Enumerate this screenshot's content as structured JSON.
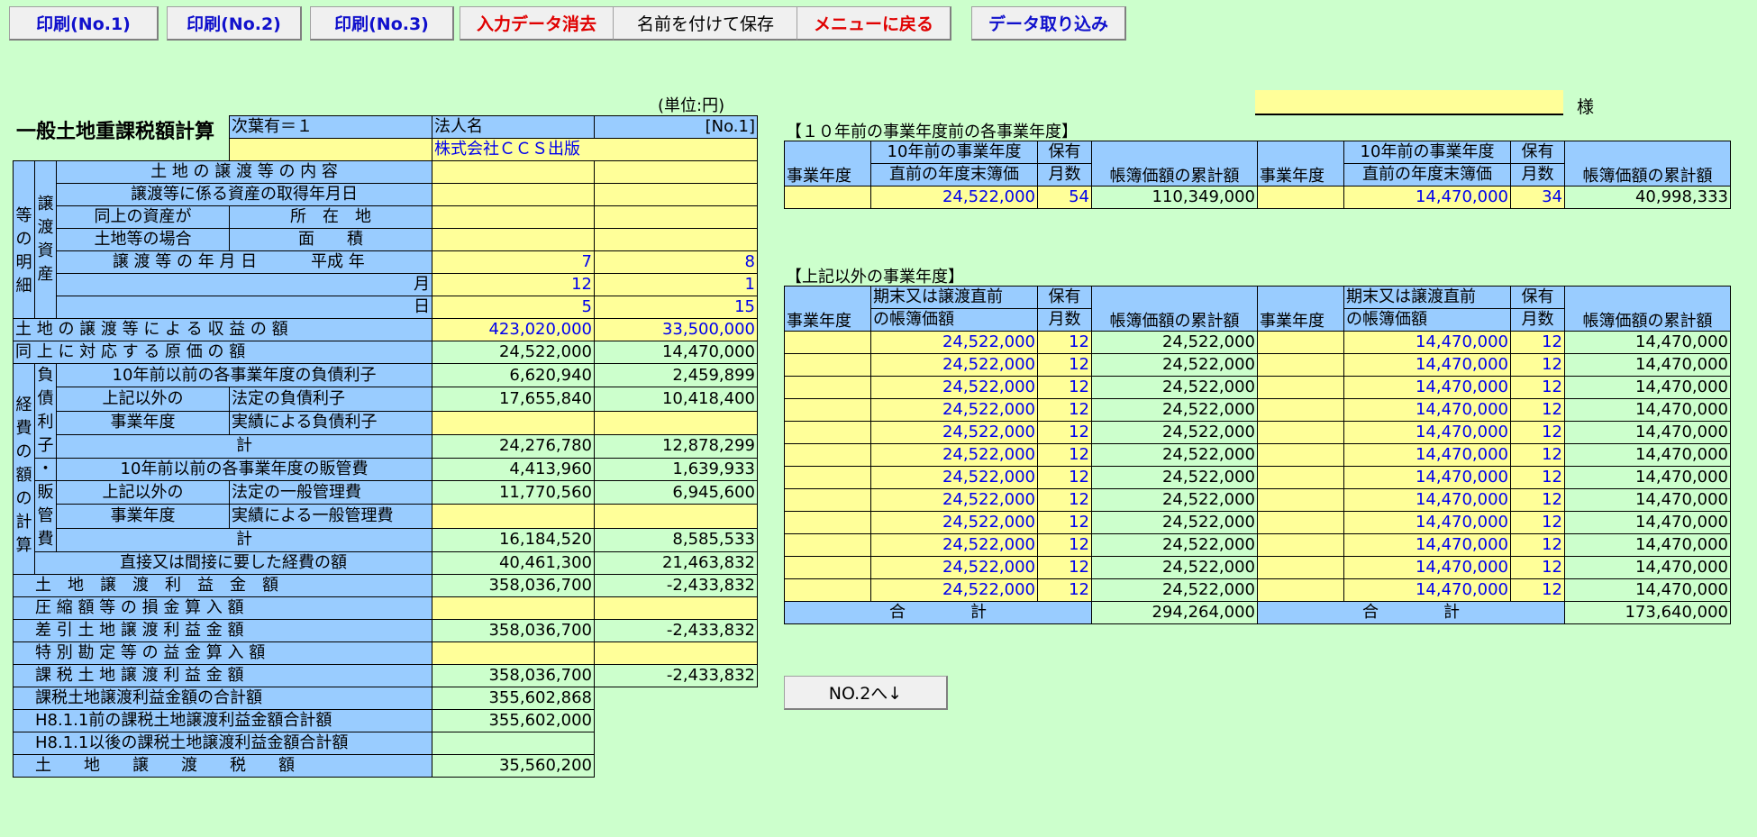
{
  "toolbar": {
    "print1": "印刷(No.1)",
    "print2": "印刷(No.2)",
    "print3": "印刷(No.3)",
    "clear": "入力データ消去",
    "save_as": "名前を付けて保存",
    "menu": "メニューに戻る",
    "import": "データ取り込み"
  },
  "page": {
    "title": "一般土地重課税額計算",
    "unit": "(単位:円)",
    "sama": "様",
    "sheet_flag": "次葉有＝１",
    "corp_label": "法人名",
    "sheet_no": "[No.1]",
    "corp_name": "株式会社ＣＣＳ出版",
    "nav_next": "NO.2へ↓"
  },
  "left": {
    "v_jouto": "譲渡",
    "v_toushi": "等の資産",
    "v_mei": "明細",
    "v_keihi": "経費の額の計算",
    "v_fusai": "負債利子",
    "v_dot": "・",
    "v_hankan": "販管費",
    "r_naiyou": "土 地 の 譲 渡 等 の 内 容",
    "r_shutoku": "譲渡等に係る資産の取得年月日",
    "r_doujou1": "同上の資産が",
    "r_doujou2": "土地等の場合",
    "r_shozai": "所　在　地",
    "r_menseki": "面　　積",
    "r_nengappi": "譲 渡 等 の 年 月 日",
    "r_heisei": "平成 年",
    "r_tsuki": "月",
    "r_hi": "日",
    "year1": "7",
    "year2": "8",
    "month1": "12",
    "month2": "1",
    "day1": "5",
    "day2": "15",
    "r_shueki": "土 地 の 譲 渡 等 に よ る 収 益 の 額",
    "shueki1": "423,020,000",
    "shueki2": "33,500,000",
    "r_genka": "同 上 に 対 応 す る 原 価 の 額",
    "genka1": "24,522,000",
    "genka2": "14,470,000",
    "r_f10": "10年前以前の各事業年度の負債利子",
    "f10_1": "6,620,940",
    "f10_2": "2,459,899",
    "r_igai1": "上記以外の",
    "r_igai2": "事業年度",
    "r_houtei_f": "法定の負債利子",
    "houtei_f1": "17,655,840",
    "houtei_f2": "10,418,400",
    "r_jisseki_f": "実績による負債利子",
    "r_kei": "計",
    "fkei1": "24,276,780",
    "fkei2": "12,878,299",
    "r_h10": "10年前以前の各事業年度の販管費",
    "h10_1": "4,413,960",
    "h10_2": "1,639,933",
    "r_houtei_h": "法定の一般管理費",
    "houtei_h1": "11,770,560",
    "houtei_h2": "6,945,600",
    "r_jisseki_h": "実績による一般管理費",
    "hkei1": "16,184,520",
    "hkei2": "8,585,533",
    "r_keihi": "直接又は間接に要した経費の額",
    "keihi1": "40,461,300",
    "keihi2": "21,463,832",
    "r_rieki": "土　地　譲　渡　利　益　金　額",
    "rieki1": "358,036,700",
    "rieki2": "-2,433,832",
    "r_asshuku": "圧 縮 額 等 の 損 金 算 入 額",
    "r_sashihiki": "差 引 土 地 譲 渡 利 益 金 額",
    "sashihiki1": "358,036,700",
    "sashihiki2": "-2,433,832",
    "r_tokubetsu": "特 別 勘 定 等 の 益 金 算 入 額",
    "r_kazei": "課 税 土 地 譲 渡 利 益 金 額",
    "kazei1": "358,036,700",
    "kazei2": "-2,433,832",
    "r_goukei": "課税土地譲渡利益金額の合計額",
    "goukei": "355,602,868",
    "r_mae": "H8.1.1前の課税土地譲渡利益金額合計額",
    "mae": "355,602,000",
    "r_go": "H8.1.1以後の課税土地譲渡利益金額合計額",
    "r_zei": "土　　地　　譲　　渡　　税　　額",
    "zei": "35,560,200"
  },
  "right_top": {
    "title": "【１０年前の事業年度前の各事業年度】",
    "h_nendo": "事業年度",
    "h_bo1": "10年前の事業年度",
    "h_bo2": "直前の年度末簿価",
    "h_ho1": "保有",
    "h_ho2": "月数",
    "h_rui": "帳簿価額の累計額",
    "bo1": "24,522,000",
    "m1": "54",
    "rui1": "110,349,000",
    "bo2": "14,470,000",
    "m2": "34",
    "rui2": "40,998,333"
  },
  "right_bottom": {
    "title": "【上記以外の事業年度】",
    "h_nendo": "事業年度",
    "h_bo1": "期末又は譲渡直前",
    "h_bo2": "の帳簿価額",
    "h_ho1": "保有",
    "h_ho2": "月数",
    "h_rui": "帳簿価額の累計額",
    "rows": [
      {
        "b1": "24,522,000",
        "m1": "12",
        "r1": "24,522,000",
        "b2": "14,470,000",
        "m2": "12",
        "r2": "14,470,000"
      },
      {
        "b1": "24,522,000",
        "m1": "12",
        "r1": "24,522,000",
        "b2": "14,470,000",
        "m2": "12",
        "r2": "14,470,000"
      },
      {
        "b1": "24,522,000",
        "m1": "12",
        "r1": "24,522,000",
        "b2": "14,470,000",
        "m2": "12",
        "r2": "14,470,000"
      },
      {
        "b1": "24,522,000",
        "m1": "12",
        "r1": "24,522,000",
        "b2": "14,470,000",
        "m2": "12",
        "r2": "14,470,000"
      },
      {
        "b1": "24,522,000",
        "m1": "12",
        "r1": "24,522,000",
        "b2": "14,470,000",
        "m2": "12",
        "r2": "14,470,000"
      },
      {
        "b1": "24,522,000",
        "m1": "12",
        "r1": "24,522,000",
        "b2": "14,470,000",
        "m2": "12",
        "r2": "14,470,000"
      },
      {
        "b1": "24,522,000",
        "m1": "12",
        "r1": "24,522,000",
        "b2": "14,470,000",
        "m2": "12",
        "r2": "14,470,000"
      },
      {
        "b1": "24,522,000",
        "m1": "12",
        "r1": "24,522,000",
        "b2": "14,470,000",
        "m2": "12",
        "r2": "14,470,000"
      },
      {
        "b1": "24,522,000",
        "m1": "12",
        "r1": "24,522,000",
        "b2": "14,470,000",
        "m2": "12",
        "r2": "14,470,000"
      },
      {
        "b1": "24,522,000",
        "m1": "12",
        "r1": "24,522,000",
        "b2": "14,470,000",
        "m2": "12",
        "r2": "14,470,000"
      },
      {
        "b1": "24,522,000",
        "m1": "12",
        "r1": "24,522,000",
        "b2": "14,470,000",
        "m2": "12",
        "r2": "14,470,000"
      },
      {
        "b1": "24,522,000",
        "m1": "12",
        "r1": "24,522,000",
        "b2": "14,470,000",
        "m2": "12",
        "r2": "14,470,000"
      }
    ],
    "total_label": "合　　　　計",
    "total1": "294,264,000",
    "total2": "173,640,000"
  }
}
